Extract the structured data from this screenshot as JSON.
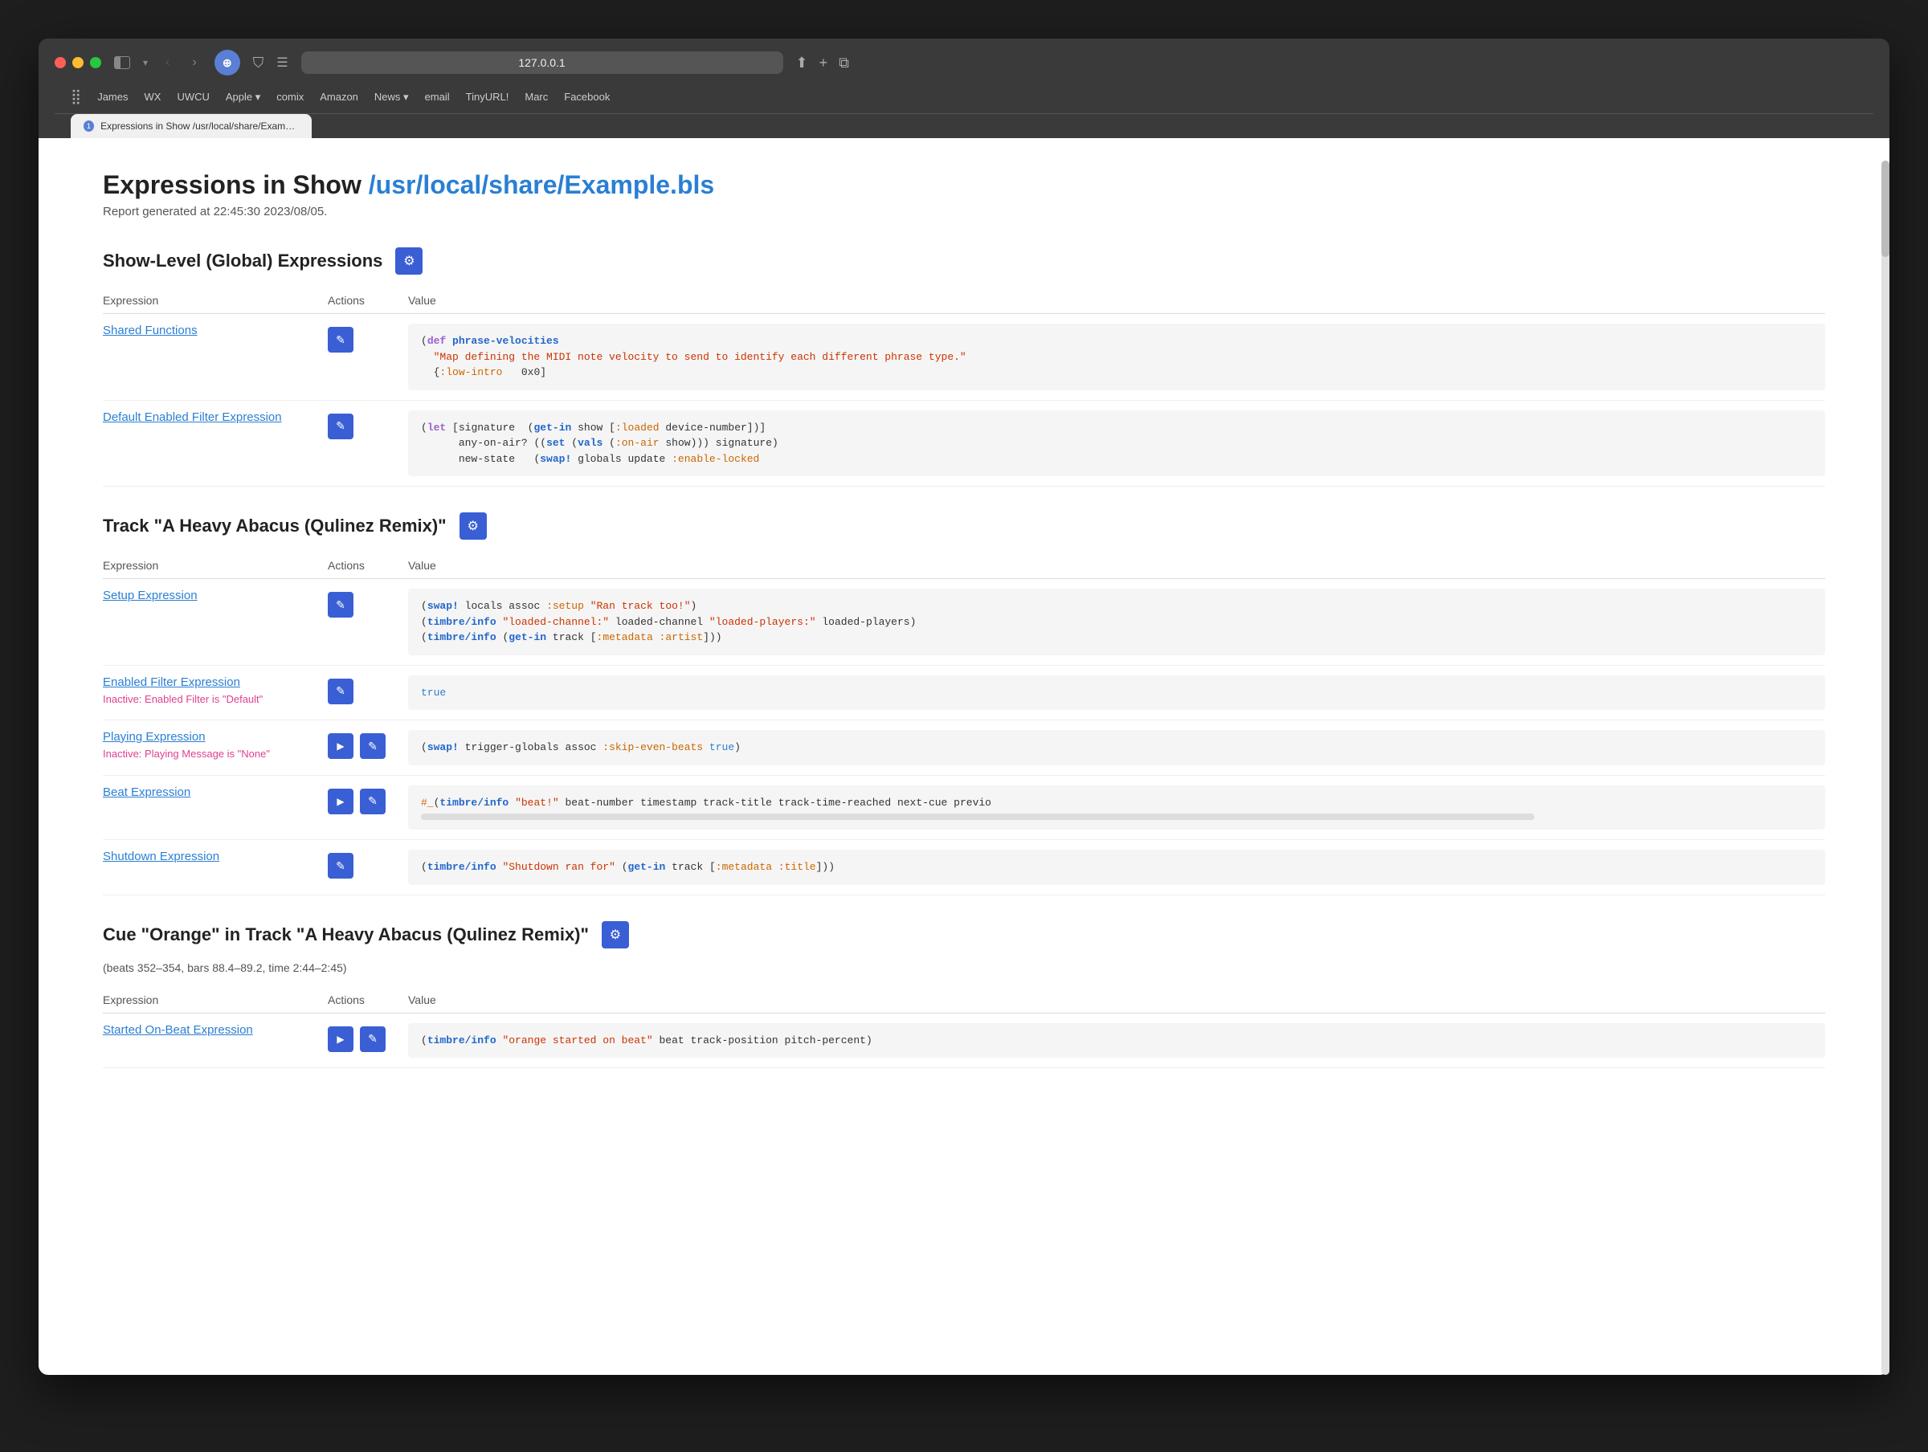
{
  "browser": {
    "url": "127.0.0.1",
    "tab_label": "Expressions in Show /usr/local/share/Example.bls",
    "traffic_lights": {
      "red": "close",
      "yellow": "minimize",
      "green": "maximize"
    },
    "bookmarks": [
      {
        "label": "James",
        "has_dropdown": false
      },
      {
        "label": "WX",
        "has_dropdown": false
      },
      {
        "label": "UWCU",
        "has_dropdown": false
      },
      {
        "label": "Apple",
        "has_dropdown": true
      },
      {
        "label": "comix",
        "has_dropdown": false
      },
      {
        "label": "Amazon",
        "has_dropdown": false
      },
      {
        "label": "News",
        "has_dropdown": true
      },
      {
        "label": "email",
        "has_dropdown": false
      },
      {
        "label": "TinyURL!",
        "has_dropdown": false
      },
      {
        "label": "Marc",
        "has_dropdown": false
      },
      {
        "label": "Facebook",
        "has_dropdown": false
      }
    ]
  },
  "page": {
    "title_prefix": "Expressions in Show ",
    "title_link": "/usr/local/share/Example.bls",
    "report_time": "Report generated at 22:45:30 2023/08/05.",
    "sections": [
      {
        "id": "global",
        "title": "Show-Level (Global) Expressions",
        "columns": [
          "Expression",
          "Actions",
          "Value"
        ],
        "rows": [
          {
            "name": "Shared Functions",
            "actions": [
              "edit"
            ],
            "code_lines": [
              "(def phrase-velocities",
              "  \"Map defining the MIDI note velocity to send to identify each different phrase type.\"",
              "  {:low-intro   0x0]"
            ],
            "code_type": "shared_functions"
          },
          {
            "name": "Default Enabled Filter Expression",
            "actions": [
              "edit"
            ],
            "code_lines": [
              "(let [signature  (get-in show [:loaded device-number])",
              "      any-on-air? ((set (vals (:on-air show))) signature)",
              "      new-state   (swap! globals update :enable-locked"
            ],
            "code_type": "filter_expression"
          }
        ]
      },
      {
        "id": "track",
        "title": "Track \"A Heavy Abacus (Qulinez Remix)\"",
        "columns": [
          "Expression",
          "Actions",
          "Value"
        ],
        "rows": [
          {
            "name": "Setup Expression",
            "actions": [
              "edit"
            ],
            "code_lines": [
              "(swap! locals assoc :setup \"Ran track too!\")",
              "(timbre/info \"loaded-channel:\" loaded-channel \"loaded-players:\" loaded-players)",
              "(timbre/info (get-in track [:metadata :artist]))"
            ],
            "code_type": "setup"
          },
          {
            "name": "Enabled Filter Expression",
            "inactive_note": "Inactive: Enabled Filter is \"Default\"",
            "actions": [
              "edit"
            ],
            "code_lines": [
              "true"
            ],
            "code_type": "enabled_filter"
          },
          {
            "name": "Playing Expression",
            "inactive_note": "Inactive: Playing Message is \"None\"",
            "actions": [
              "play",
              "edit"
            ],
            "code_lines": [
              "(swap! trigger-globals assoc :skip-even-beats true)"
            ],
            "code_type": "playing"
          },
          {
            "name": "Beat Expression",
            "actions": [
              "play",
              "edit"
            ],
            "code_lines": [
              "#_(timbre/info \"beat!\" beat-number timestamp track-title track-time-reached next-cue previo"
            ],
            "has_scrollbar": true,
            "code_type": "beat"
          },
          {
            "name": "Shutdown Expression",
            "actions": [
              "edit"
            ],
            "code_lines": [
              "(timbre/info \"Shutdown ran for\" (get-in track [:metadata :title]))"
            ],
            "code_type": "shutdown"
          }
        ]
      },
      {
        "id": "cue",
        "title": "Cue \"Orange\" in Track \"A Heavy Abacus (Qulinez Remix)\"",
        "subtitle": "(beats 352–354, bars 88.4–89.2, time 2:44–2:45)",
        "columns": [
          "Expression",
          "Actions",
          "Value"
        ],
        "rows": [
          {
            "name": "Started On-Beat Expression",
            "actions": [
              "play",
              "edit"
            ],
            "code_lines": [
              "(timbre/info \"orange started on beat\" beat track-position pitch-percent)"
            ],
            "code_type": "cue_started"
          }
        ]
      }
    ]
  }
}
